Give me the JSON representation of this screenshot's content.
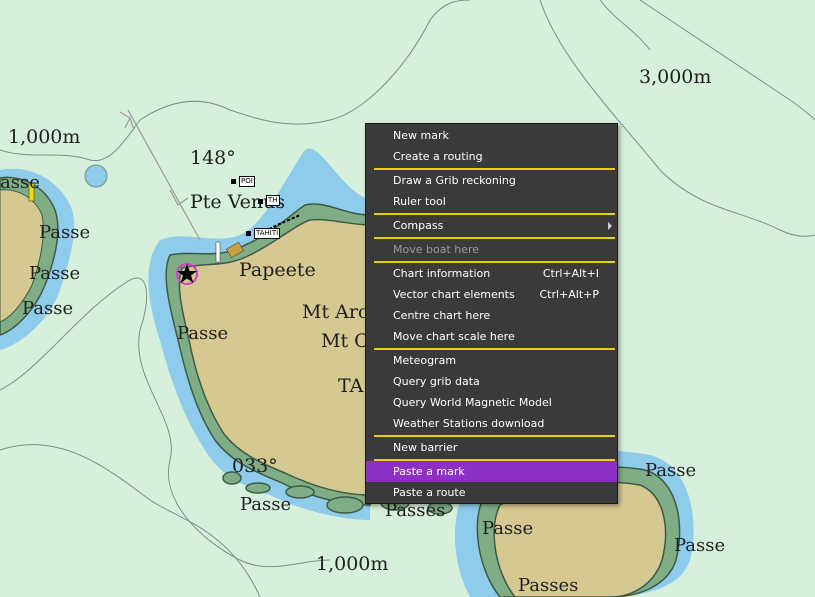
{
  "map": {
    "depth_labels": {
      "top_right": "3,000m",
      "top_left": "1,000m",
      "bottom": "1,000m"
    },
    "bearing_labels": {
      "north": "148°",
      "south": "033°"
    },
    "place_labels": {
      "pte_venus": "Pte Venus",
      "papeete": "Papeete",
      "mt_line1": "Mt Aro",
      "mt_line2": "Mt O",
      "ta": "TA",
      "left_island_top": "asse",
      "passe": "Passe",
      "passes": "Passes"
    },
    "poi_tags": {
      "poi1": "POI",
      "poi2": "TH",
      "poi3": "TAHITI"
    },
    "colors": {
      "shallow_green": "#d6f0dc",
      "water_blue": "#8fcbea",
      "land": "#d5c890",
      "reef_green": "#7fae86",
      "coast_line": "#3d5a46",
      "depth_contour": "#7d8f87"
    }
  },
  "context_menu": {
    "groups": [
      [
        {
          "label": "New mark"
        },
        {
          "label": "Create a routing"
        }
      ],
      [
        {
          "label": "Draw a Grib reckoning"
        },
        {
          "label": "Ruler tool"
        }
      ],
      [
        {
          "label": "Compass",
          "submenu": true
        }
      ],
      [
        {
          "label": "Move boat here",
          "disabled": true
        }
      ],
      [
        {
          "label": "Chart information",
          "shortcut": "Ctrl+Alt+I"
        },
        {
          "label": "Vector chart elements",
          "shortcut": "Ctrl+Alt+P"
        },
        {
          "label": "Centre chart here"
        },
        {
          "label": "Move chart scale here"
        }
      ],
      [
        {
          "label": "Meteogram"
        },
        {
          "label": "Query grib data"
        },
        {
          "label": "Query World Magnetic Model"
        },
        {
          "label": "Weather Stations download"
        }
      ],
      [
        {
          "label": "New barrier"
        }
      ],
      [
        {
          "label": "Paste a mark",
          "highlighted": true
        },
        {
          "label": "Paste a route"
        }
      ]
    ]
  }
}
